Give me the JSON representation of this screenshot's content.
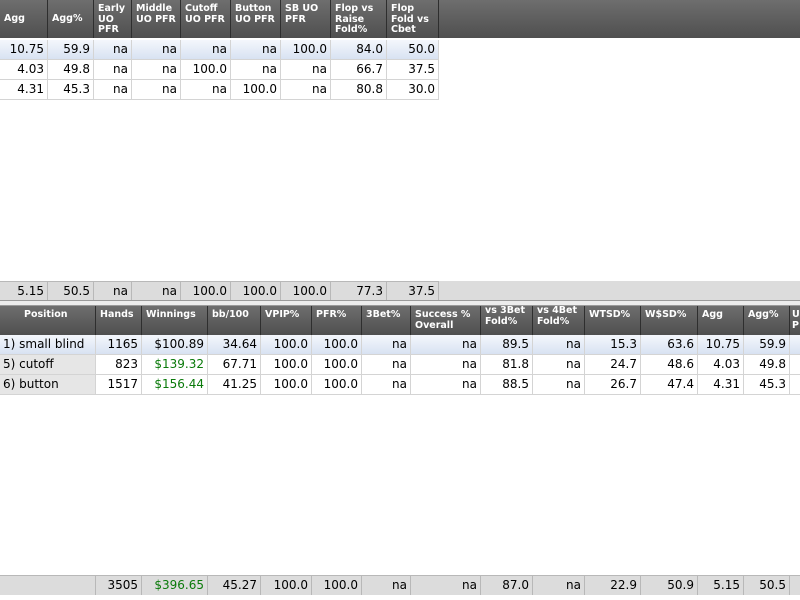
{
  "top_table": {
    "columns": [
      {
        "key": "agg",
        "label": "Agg"
      },
      {
        "key": "aggp",
        "label": "Agg%"
      },
      {
        "key": "early",
        "label": "Early UO PFR"
      },
      {
        "key": "middle",
        "label": "Middle UO PFR"
      },
      {
        "key": "cutoff",
        "label": "Cutoff UO PFR"
      },
      {
        "key": "button",
        "label": "Button UO PFR"
      },
      {
        "key": "sb",
        "label": "SB UO PFR"
      },
      {
        "key": "fvrf",
        "label": "Flop vs Raise Fold%"
      },
      {
        "key": "ffvc",
        "label": "Flop Fold vs Cbet"
      }
    ],
    "rows": [
      [
        "10.75",
        "59.9",
        "na",
        "na",
        "na",
        "na",
        "100.0",
        "84.0",
        "50.0"
      ],
      [
        "4.03",
        "49.8",
        "na",
        "na",
        "100.0",
        "na",
        "na",
        "66.7",
        "37.5"
      ],
      [
        "4.31",
        "45.3",
        "na",
        "na",
        "na",
        "100.0",
        "na",
        "80.8",
        "30.0"
      ]
    ],
    "totals": [
      "5.15",
      "50.5",
      "na",
      "na",
      "100.0",
      "100.0",
      "100.0",
      "77.3",
      "37.5"
    ]
  },
  "bottom_table": {
    "columns": [
      {
        "key": "position",
        "label": "Position"
      },
      {
        "key": "hands",
        "label": "Hands"
      },
      {
        "key": "winnings",
        "label": "Winnings"
      },
      {
        "key": "bb100",
        "label": "bb/100"
      },
      {
        "key": "vpip",
        "label": "VPIP%"
      },
      {
        "key": "pfr",
        "label": "PFR%"
      },
      {
        "key": "3bet",
        "label": "3Bet%"
      },
      {
        "key": "success",
        "label": "Success % Overall"
      },
      {
        "key": "vs3bet",
        "label": "vs 3Bet Fold%"
      },
      {
        "key": "vs4bet",
        "label": "vs 4Bet Fold%"
      },
      {
        "key": "wtsd",
        "label": "WTSD%"
      },
      {
        "key": "wsd",
        "label": "W$SD%"
      },
      {
        "key": "agg",
        "label": "Agg"
      },
      {
        "key": "aggp",
        "label": "Agg%"
      },
      {
        "key": "uo",
        "label": "U P"
      }
    ],
    "rows": [
      [
        "1) small blind",
        "1165",
        "$100.89",
        "34.64",
        "100.0",
        "100.0",
        "na",
        "na",
        "89.5",
        "na",
        "15.3",
        "63.6",
        "10.75",
        "59.9",
        ""
      ],
      [
        "5) cutoff",
        "823",
        "$139.32",
        "67.71",
        "100.0",
        "100.0",
        "na",
        "na",
        "81.8",
        "na",
        "24.7",
        "48.6",
        "4.03",
        "49.8",
        ""
      ],
      [
        "6) button",
        "1517",
        "$156.44",
        "41.25",
        "100.0",
        "100.0",
        "na",
        "na",
        "88.5",
        "na",
        "26.7",
        "47.4",
        "4.31",
        "45.3",
        ""
      ]
    ],
    "totals": [
      "",
      "3505",
      "$396.65",
      "45.27",
      "100.0",
      "100.0",
      "na",
      "na",
      "87.0",
      "na",
      "22.9",
      "50.9",
      "5.15",
      "50.5",
      ""
    ]
  },
  "colors": {
    "header_bg": "#5a5a5a",
    "selected_row": "#d8e2f2",
    "winnings_green": "#0a7a0a",
    "total_bg": "#dcdcdc"
  }
}
